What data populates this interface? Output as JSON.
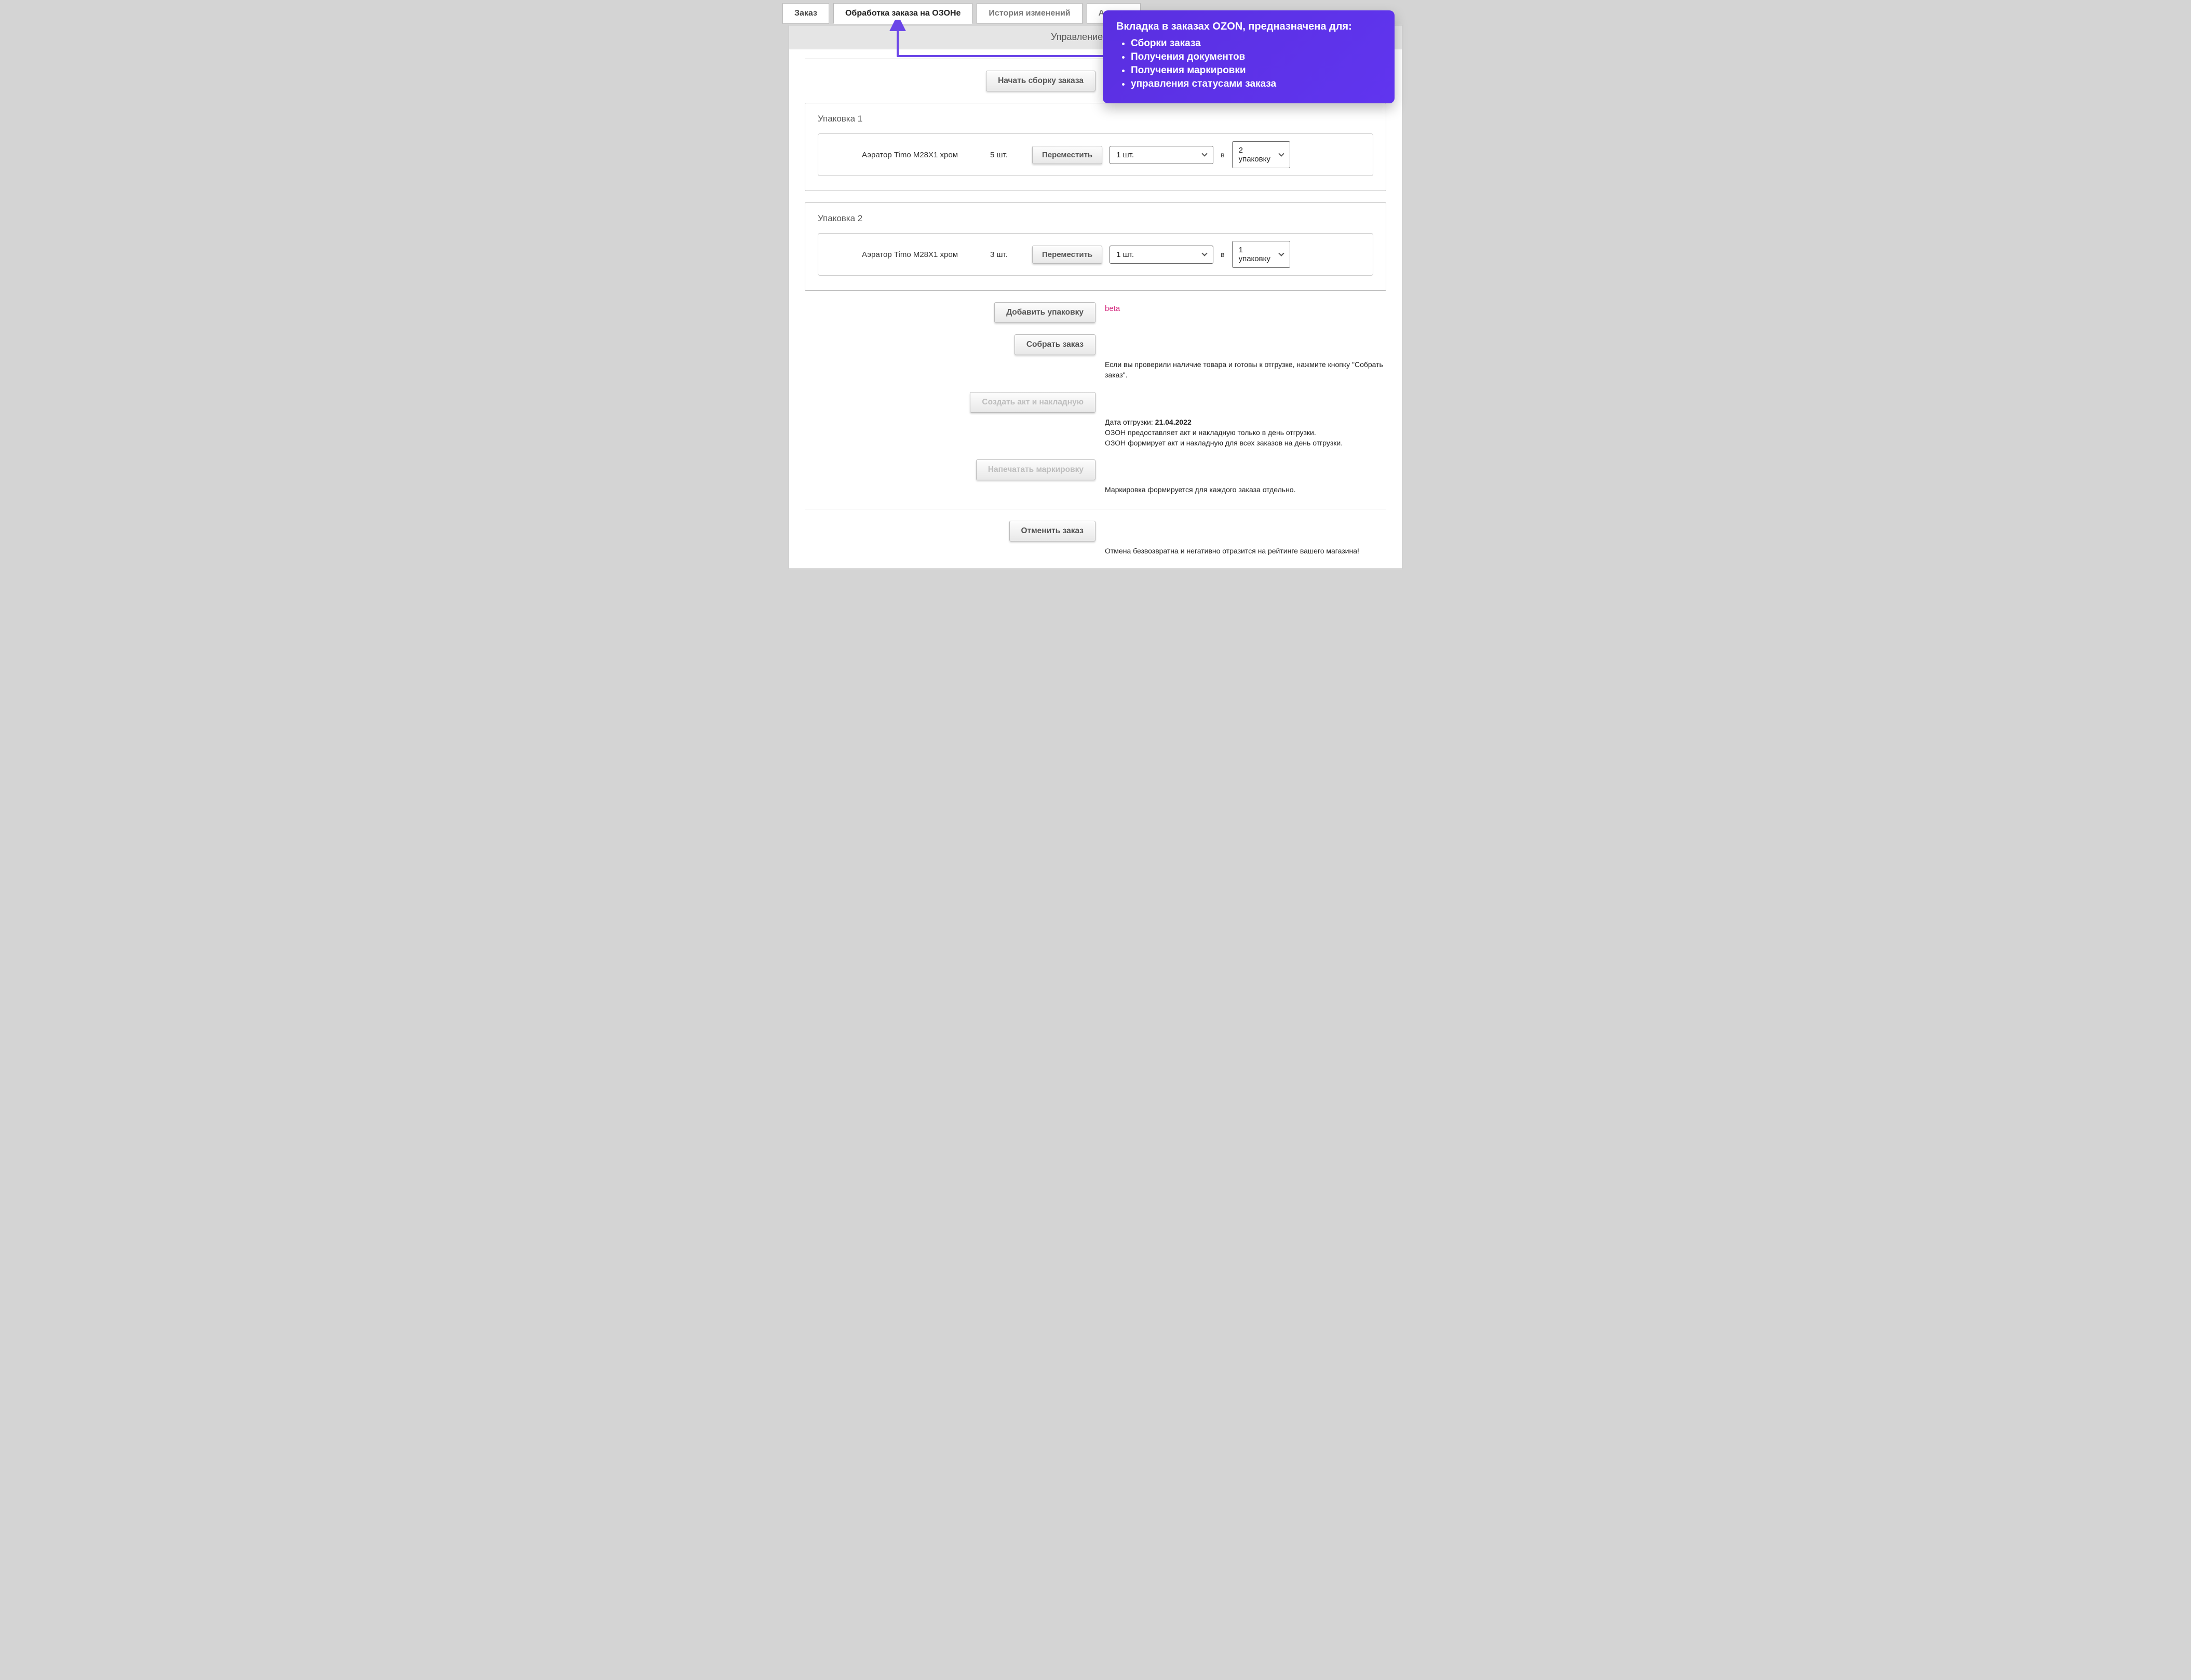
{
  "tabs": {
    "order": "Заказ",
    "processing": "Обработка заказа на ОЗОНе",
    "history": "История изменений",
    "analysis": "Анализ"
  },
  "panel": {
    "header": "Управление заказом"
  },
  "buttons": {
    "start_assembly": "Начать сборку заказа",
    "move": "Переместить",
    "add_package": "Добавить упаковку",
    "collect_order": "Собрать заказ",
    "create_act": "Создать акт и накладную",
    "print_labels": "Напечатать маркировку",
    "cancel_order": "Отменить заказ"
  },
  "common": {
    "in": "в",
    "beta": "beta"
  },
  "packages": [
    {
      "title": "Упаковка 1",
      "item_name": "Аэратор Timo M28X1 хром",
      "item_qty": "5 шт.",
      "move_qty_selected": "1 шт.",
      "move_dest_selected": "2 упаковку"
    },
    {
      "title": "Упаковка 2",
      "item_name": "Аэратор Timo M28X1 хром",
      "item_qty": "3 шт.",
      "move_qty_selected": "1 шт.",
      "move_dest_selected": "1 упаковку"
    }
  ],
  "info": {
    "collect_hint": "Если вы проверили наличие товара и готовы к отгрузке, нажмите кнопку \"Собрать заказ\".",
    "ship_date_label": "Дата отгрузки: ",
    "ship_date": "21.04.2022",
    "act_note1": "ОЗОН предоставляет акт и накладную только в день отгрузки.",
    "act_note2": "ОЗОН формирует акт и накладную для всех заказов на день отгрузки.",
    "labels_note": "Маркировка формируется для каждого заказа отдельно.",
    "cancel_note": "Отмена безвозвратна и негативно отразится на рейтинге вашего магазина!"
  },
  "tooltip": {
    "title": "Вкладка в заказах OZON, предназначена для:",
    "items": [
      "Сборки заказа",
      "Получения документов",
      "Получения маркировки",
      "управления статусами заказа"
    ]
  }
}
